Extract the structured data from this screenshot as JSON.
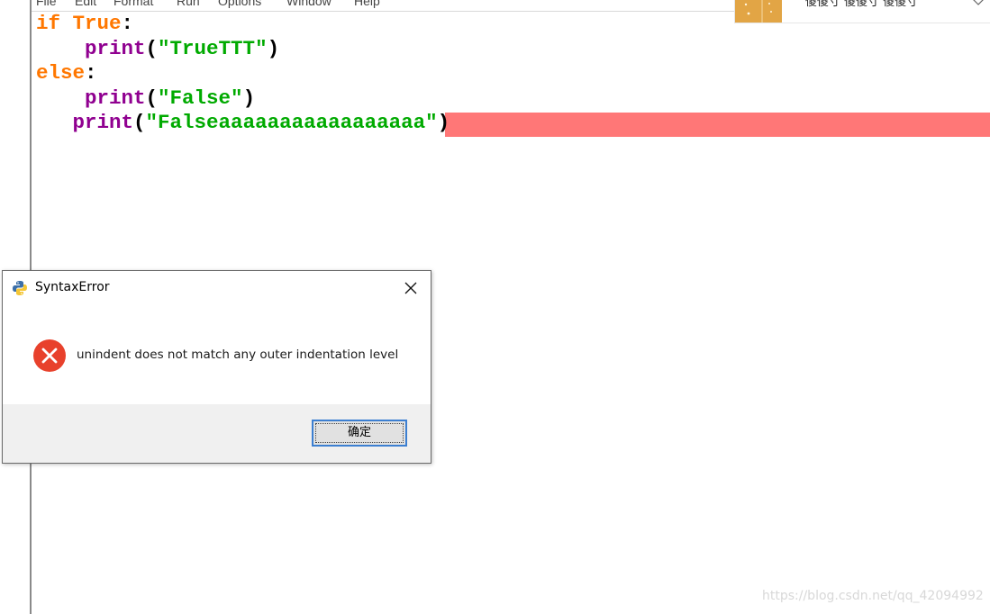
{
  "menubar": {
    "items": [
      {
        "label": "File"
      },
      {
        "label": "Edit"
      },
      {
        "label": "Format"
      },
      {
        "label": "Run"
      },
      {
        "label": "Options"
      },
      {
        "label": "Window"
      },
      {
        "label": "Help"
      }
    ]
  },
  "code": {
    "lines": [
      {
        "indent": "",
        "tokens": [
          {
            "t": "if",
            "c": "kw"
          },
          {
            "t": " ",
            "c": ""
          },
          {
            "t": "True",
            "c": "kw"
          },
          {
            "t": ":",
            "c": ""
          }
        ]
      },
      {
        "indent": "    ",
        "tokens": [
          {
            "t": "print",
            "c": "bi"
          },
          {
            "t": "(",
            "c": ""
          },
          {
            "t": "\"TrueTTT\"",
            "c": "str"
          },
          {
            "t": ")",
            "c": ""
          }
        ]
      },
      {
        "indent": "",
        "tokens": [
          {
            "t": "else",
            "c": "kw"
          },
          {
            "t": ":",
            "c": ""
          }
        ]
      },
      {
        "indent": "    ",
        "tokens": [
          {
            "t": "print",
            "c": "bi"
          },
          {
            "t": "(",
            "c": ""
          },
          {
            "t": "\"False\"",
            "c": "str"
          },
          {
            "t": ")",
            "c": ""
          }
        ]
      },
      {
        "indent": "   ",
        "tokens": [
          {
            "t": "print",
            "c": "bi"
          },
          {
            "t": "(",
            "c": ""
          },
          {
            "t": "\"Falseaaaaaaaaaaaaaaaaa\"",
            "c": "str"
          },
          {
            "t": ")",
            "c": ""
          }
        ]
      }
    ],
    "error_highlight_color": "#ff7777"
  },
  "top_panel": {
    "text": "傻傻寸 傻傻寸 傻傻寸",
    "thumb_color": "#e2a545",
    "icon": "heart-icon"
  },
  "dialog": {
    "title": "SyntaxError",
    "title_icon": "python-icon",
    "message": "unindent does not match any outer indentation level",
    "message_icon": "error-icon",
    "ok_label": "确定",
    "close_icon": "close-icon",
    "error_icon_color": "#e8412c",
    "ok_border_color": "#3c7fd1"
  },
  "watermark": {
    "text": "https://blog.csdn.net/qq_42094992"
  }
}
